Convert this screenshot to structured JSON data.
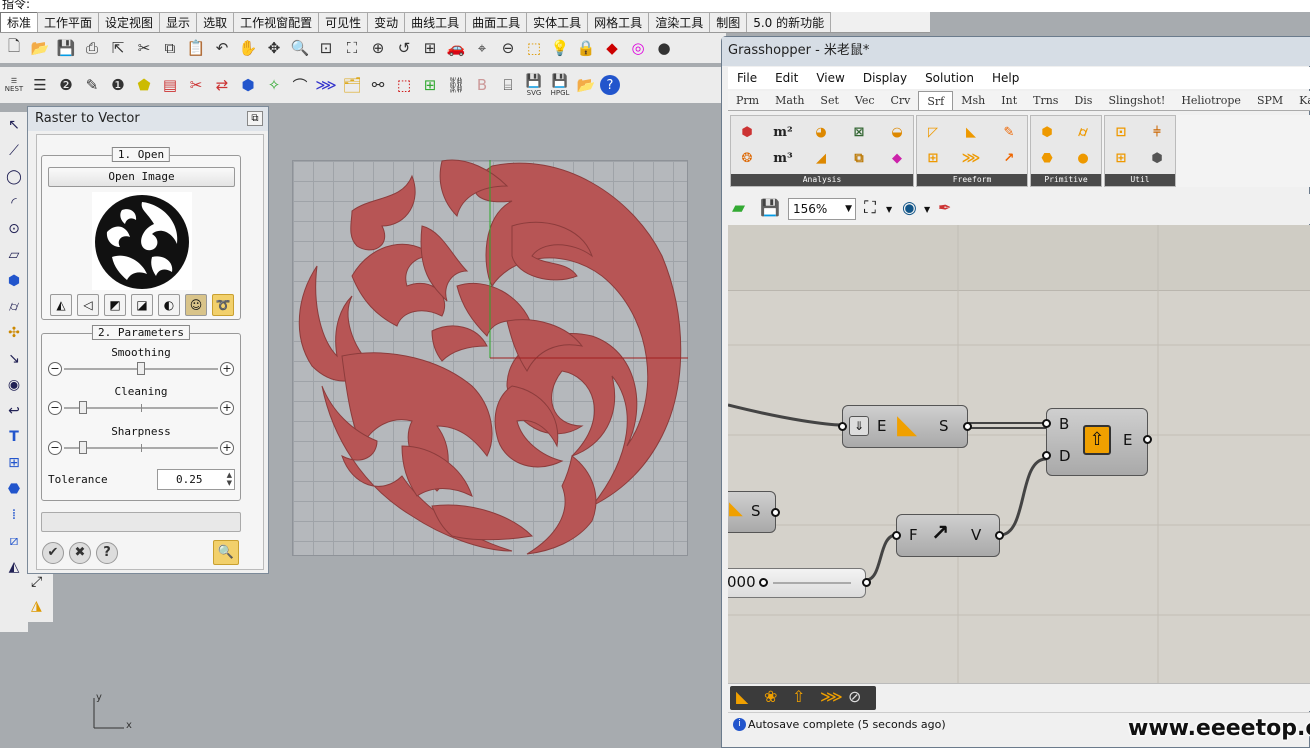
{
  "command_line": {
    "prompt": "指令:"
  },
  "rhino_tabs": [
    "标准",
    "工作平面",
    "设定视图",
    "显示",
    "选取",
    "工作视窗配置",
    "可见性",
    "变动",
    "曲线工具",
    "曲面工具",
    "实体工具",
    "网格工具",
    "渲染工具",
    "制图",
    "5.0 的新功能"
  ],
  "rhino_toolbar": {
    "nest_label": "NEST",
    "svg_label": "SVG",
    "hpgl_label": "HPGL"
  },
  "raster_panel": {
    "title": "Raster to Vector",
    "open_group": "1. Open",
    "open_button": "Open Image",
    "params_group": "2. Parameters",
    "smoothing_label": "Smoothing",
    "smoothing_value": 0.5,
    "cleaning_label": "Cleaning",
    "cleaning_value": 0.1,
    "sharpness_label": "Sharpness",
    "sharpness_value": 0.1,
    "tolerance_label": "Tolerance",
    "tolerance_value": "0.25",
    "ok_icon": "check-icon",
    "cancel_icon": "x-icon",
    "help_icon": "question-icon"
  },
  "viewport": {
    "axis_x": "x",
    "axis_y": "y"
  },
  "grasshopper": {
    "title": "Grasshopper - 米老鼠*",
    "menu": [
      "File",
      "Edit",
      "View",
      "Display",
      "Solution",
      "Help"
    ],
    "component_tabs": [
      "Prm",
      "Math",
      "Set",
      "Vec",
      "Crv",
      "Srf",
      "Msh",
      "Int",
      "Trns",
      "Dis",
      "Slingshot!",
      "Heliotrope",
      "SPM",
      "Kang"
    ],
    "active_tab": "Srf",
    "panels": [
      "Analysis",
      "Freeform",
      "Primitive",
      "Util"
    ],
    "zoom": "156%",
    "components": {
      "extrude": {
        "in": "E",
        "out": "S"
      },
      "boundary": {
        "in1": "B",
        "in2": "D",
        "out": "E"
      },
      "partial": {
        "out": "S"
      },
      "vector": {
        "in": "F",
        "out": "V"
      },
      "slider_value": "000"
    },
    "status": "Autosave complete (5 seconds ago)"
  },
  "watermark": "www.eeeetop.com"
}
